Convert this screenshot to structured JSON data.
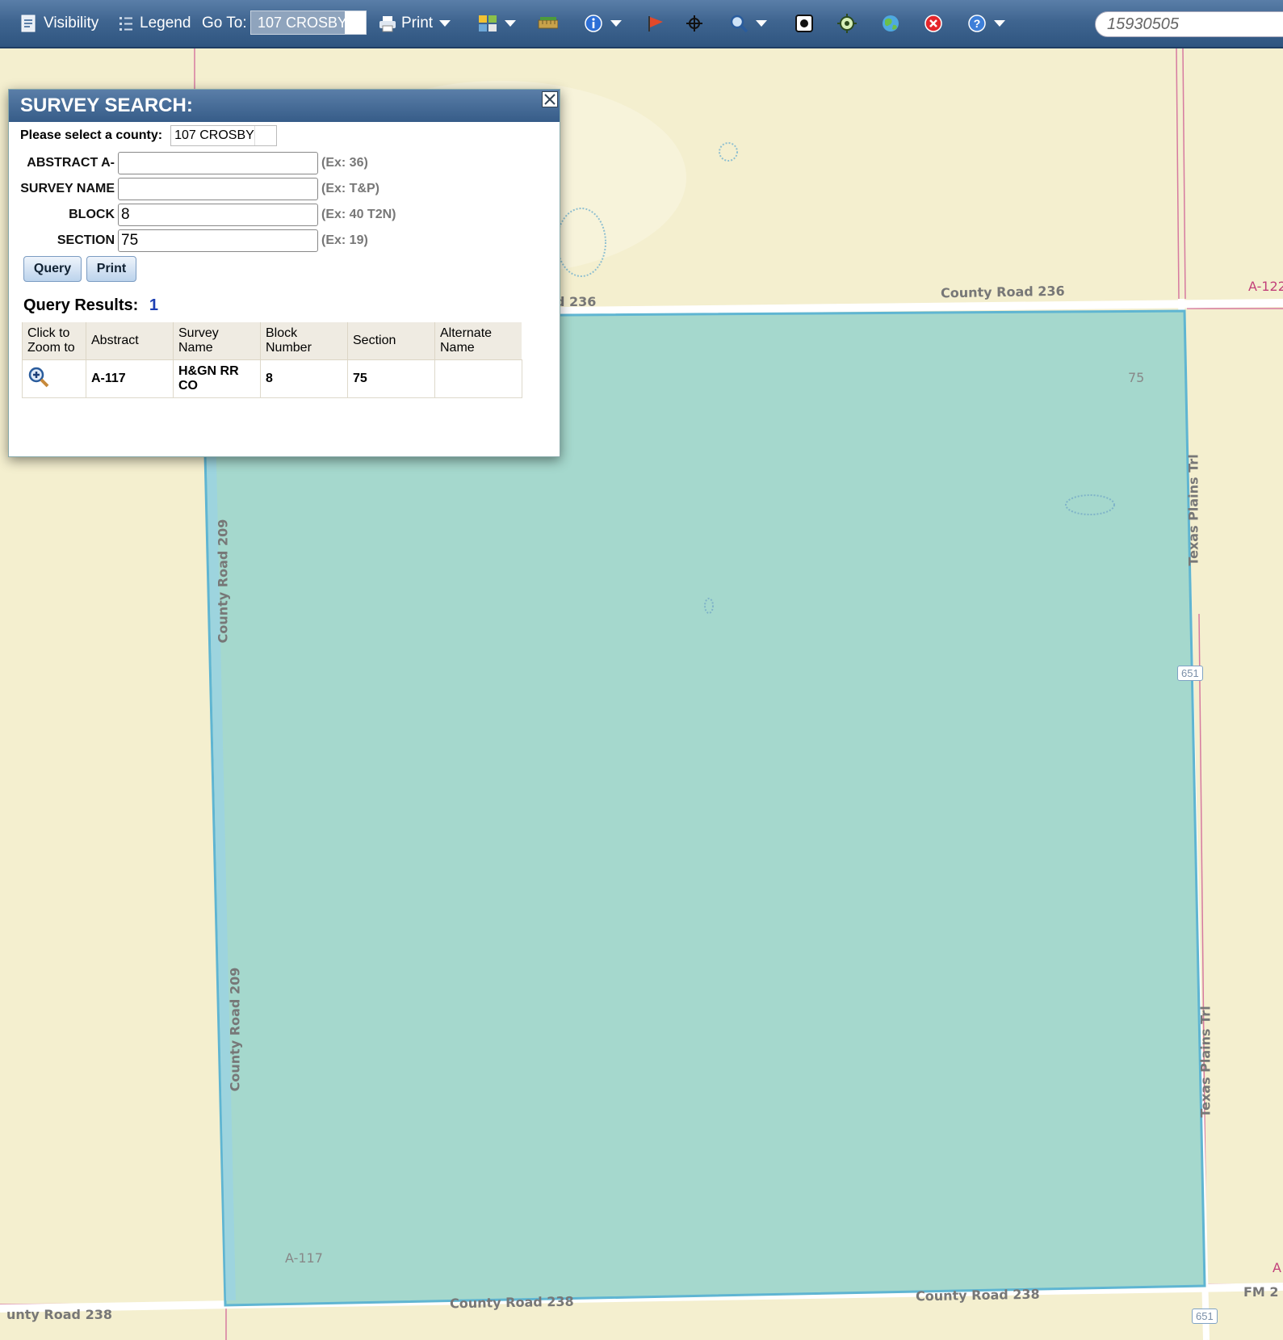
{
  "toolbar": {
    "visibility": "Visibility",
    "legend": "Legend",
    "goto_label": "Go To:",
    "goto_value": "107 CROSBY",
    "print": "Print",
    "search_value": "15930505"
  },
  "map": {
    "labels": {
      "county_road_236_top": "County Road 236",
      "county_road_236_left": "d 236",
      "county_road_209_upper": "County Road 209",
      "county_road_209_lower": "County Road 209",
      "county_road_238_left": "unty Road 238",
      "county_road_238_mid": "County Road 238",
      "county_road_238_right": "County Road 238",
      "texas_plains_upper": "Texas Plains Trl",
      "texas_plains_lower": "Texas Plains Trl",
      "section_75": "75",
      "abstract_a117": "A-117",
      "abstract_a122": "A-122",
      "abstract_a_edge": "A",
      "fm_edge": "FM 2",
      "shield_651_mid": "651",
      "shield_651_bottom": "651"
    },
    "colors": {
      "background": "#f4efcf",
      "parcel_fill": "#a5d8cd",
      "parcel_stroke": "#5fb5d2",
      "road": "#ffffff",
      "boundary": "#d67aa0"
    }
  },
  "dialog": {
    "title": "SURVEY SEARCH:",
    "close_icon": "close-icon",
    "county_label": "Please select a county:",
    "county_value": "107 CROSBY",
    "fields": {
      "abstract": {
        "label": "ABSTRACT A-",
        "value": "",
        "hint": "(Ex: 36)"
      },
      "survey": {
        "label": "SURVEY NAME",
        "value": "",
        "hint": "(Ex: T&P)"
      },
      "block": {
        "label": "BLOCK",
        "value": "8",
        "hint": "(Ex: 40 T2N)"
      },
      "section": {
        "label": "SECTION",
        "value": "75",
        "hint": "(Ex: 19)"
      }
    },
    "query_button": "Query",
    "print_button": "Print",
    "results_label": "Query Results:",
    "results_count": "1",
    "columns": {
      "zoom1": "Click to",
      "zoom2": "Zoom to",
      "abstract": "Abstract",
      "survey1": "Survey",
      "survey2": "Name",
      "block1": "Block",
      "block2": "Number",
      "section": "Section",
      "alt1": "Alternate",
      "alt2": "Name"
    },
    "row": {
      "abstract": "A-117",
      "survey1": "H&GN RR",
      "survey2": "CO",
      "block": "8",
      "section": "75",
      "alternate": ""
    }
  }
}
